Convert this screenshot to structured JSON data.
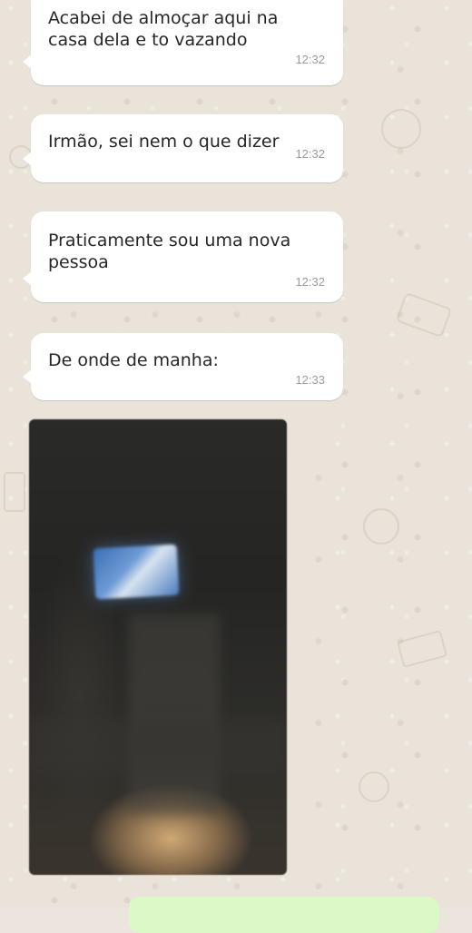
{
  "messages": [
    {
      "text": "Acabei de almoçar aqui na\ncasa dela e to vazando",
      "time": "12:32"
    },
    {
      "text": "Irmão, sei nem o que dizer",
      "time": "12:32"
    },
    {
      "text": "Praticamente sou uma nova\npessoa",
      "time": "12:32"
    },
    {
      "text": "De onde de manha:",
      "time": "12:33"
    }
  ],
  "colors": {
    "incoming_bubble": "#ffffff",
    "outgoing_bubble": "#dcf8c6",
    "chat_background": "#e9e3da",
    "timestamp": "#9a9a9a"
  }
}
